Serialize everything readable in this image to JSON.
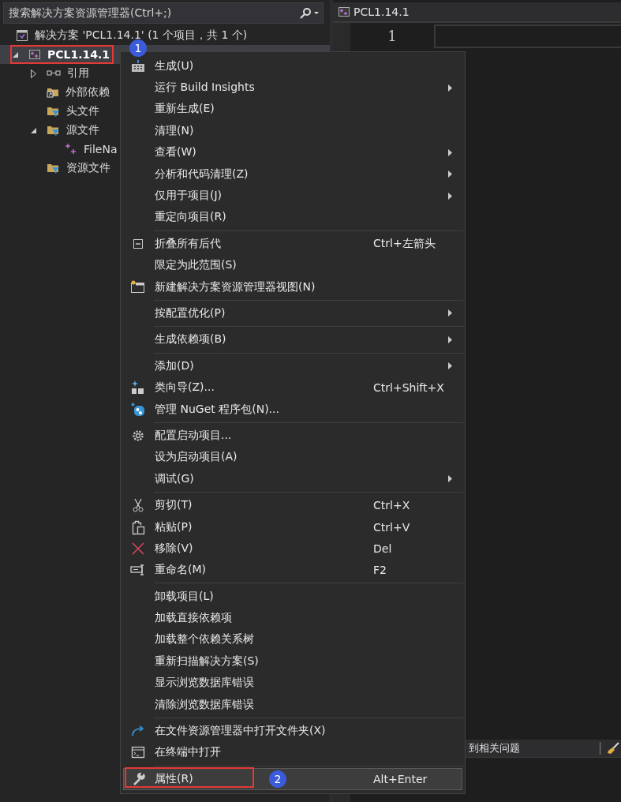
{
  "search": {
    "placeholder": "搜索解决方案资源管理器(Ctrl+;)"
  },
  "tree": [
    {
      "label": "解决方案 'PCL1.14.1' (1 个项目，共 1 个)",
      "selected": false,
      "children": [
        {
          "label": "PCL1.14.1",
          "selected": true,
          "expanded": true,
          "startup": true,
          "highlighted": true,
          "marker": "1",
          "children": [
            {
              "label": "引用",
              "selected": false,
              "expanded": false
            },
            {
              "label": "外部依赖",
              "selected": false
            },
            {
              "label": "头文件",
              "selected": false
            },
            {
              "label": "源文件",
              "selected": false,
              "expanded": true,
              "children": [
                {
                  "label": "FileNa",
                  "selected": false
                }
              ]
            },
            {
              "label": "资源文件",
              "selected": false
            }
          ]
        }
      ]
    }
  ],
  "editor": {
    "tab": "PCL1.14.1",
    "line_number": "1",
    "toolbar_text": "到相关问题"
  },
  "context_menu": [
    {
      "kind": "item",
      "label": "生成(U)",
      "selected": false
    },
    {
      "kind": "item",
      "label": "运行 Build Insights",
      "submenu": true,
      "selected": false
    },
    {
      "kind": "item",
      "label": "重新生成(E)",
      "selected": false
    },
    {
      "kind": "item",
      "label": "清理(N)",
      "selected": false
    },
    {
      "kind": "item",
      "label": "查看(W)",
      "submenu": true,
      "selected": false
    },
    {
      "kind": "item",
      "label": "分析和代码清理(Z)",
      "submenu": true,
      "selected": false
    },
    {
      "kind": "item",
      "label": "仅用于项目(J)",
      "submenu": true,
      "selected": false
    },
    {
      "kind": "item",
      "label": "重定向项目(R)",
      "selected": false
    },
    {
      "kind": "separator"
    },
    {
      "kind": "item",
      "label": "折叠所有后代",
      "shortcut": "Ctrl+左箭头",
      "selected": false
    },
    {
      "kind": "item",
      "label": "限定为此范围(S)",
      "selected": false
    },
    {
      "kind": "item",
      "label": "新建解决方案资源管理器视图(N)",
      "selected": false
    },
    {
      "kind": "separator"
    },
    {
      "kind": "item",
      "label": "按配置优化(P)",
      "submenu": true,
      "selected": false
    },
    {
      "kind": "separator"
    },
    {
      "kind": "item",
      "label": "生成依赖项(B)",
      "submenu": true,
      "selected": false
    },
    {
      "kind": "separator"
    },
    {
      "kind": "item",
      "label": "添加(D)",
      "submenu": true,
      "selected": false
    },
    {
      "kind": "item",
      "label": "类向导(Z)...",
      "shortcut": "Ctrl+Shift+X",
      "selected": false
    },
    {
      "kind": "item",
      "label": "管理 NuGet 程序包(N)...",
      "selected": false
    },
    {
      "kind": "separator"
    },
    {
      "kind": "item",
      "label": "配置启动项目...",
      "selected": false
    },
    {
      "kind": "item",
      "label": "设为启动项目(A)",
      "selected": false
    },
    {
      "kind": "item",
      "label": "调试(G)",
      "submenu": true,
      "selected": false
    },
    {
      "kind": "separator"
    },
    {
      "kind": "item",
      "label": "剪切(T)",
      "shortcut": "Ctrl+X",
      "selected": false
    },
    {
      "kind": "item",
      "label": "粘贴(P)",
      "shortcut": "Ctrl+V",
      "selected": false
    },
    {
      "kind": "item",
      "label": "移除(V)",
      "shortcut": "Del",
      "selected": false
    },
    {
      "kind": "item",
      "label": "重命名(M)",
      "shortcut": "F2",
      "selected": false
    },
    {
      "kind": "separator"
    },
    {
      "kind": "item",
      "label": "卸载项目(L)",
      "selected": false
    },
    {
      "kind": "item",
      "label": "加载直接依赖项",
      "selected": false
    },
    {
      "kind": "item",
      "label": "加载整个依赖关系树",
      "selected": false
    },
    {
      "kind": "item",
      "label": "重新扫描解决方案(S)",
      "selected": false
    },
    {
      "kind": "item",
      "label": "显示浏览数据库错误",
      "selected": false
    },
    {
      "kind": "item",
      "label": "清除浏览数据库错误",
      "selected": false
    },
    {
      "kind": "separator"
    },
    {
      "kind": "item",
      "label": "在文件资源管理器中打开文件夹(X)",
      "selected": false
    },
    {
      "kind": "item",
      "label": "在终端中打开",
      "selected": false
    },
    {
      "kind": "separator"
    },
    {
      "kind": "item",
      "label": "属性(R)",
      "shortcut": "Alt+Enter",
      "selected": true,
      "highlighted": true,
      "marker": "2"
    }
  ]
}
